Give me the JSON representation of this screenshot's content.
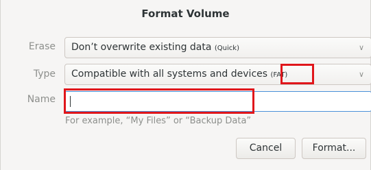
{
  "dialog": {
    "title": "Format Volume"
  },
  "erase": {
    "label": "Erase",
    "value": "Don’t overwrite existing data",
    "value_sub": "(Quick)"
  },
  "type": {
    "label": "Type",
    "value": "Compatible with all systems and devices",
    "value_sub": "(FAT)"
  },
  "name": {
    "label": "Name",
    "value": "",
    "hint": "For example, “My Files” or “Backup Data”"
  },
  "buttons": {
    "cancel": "Cancel",
    "format": "Format..."
  },
  "icons": {
    "dropdown": "chevron-down-icon"
  },
  "colors": {
    "highlight": "#e0161b",
    "focus": "#4a90d9"
  }
}
